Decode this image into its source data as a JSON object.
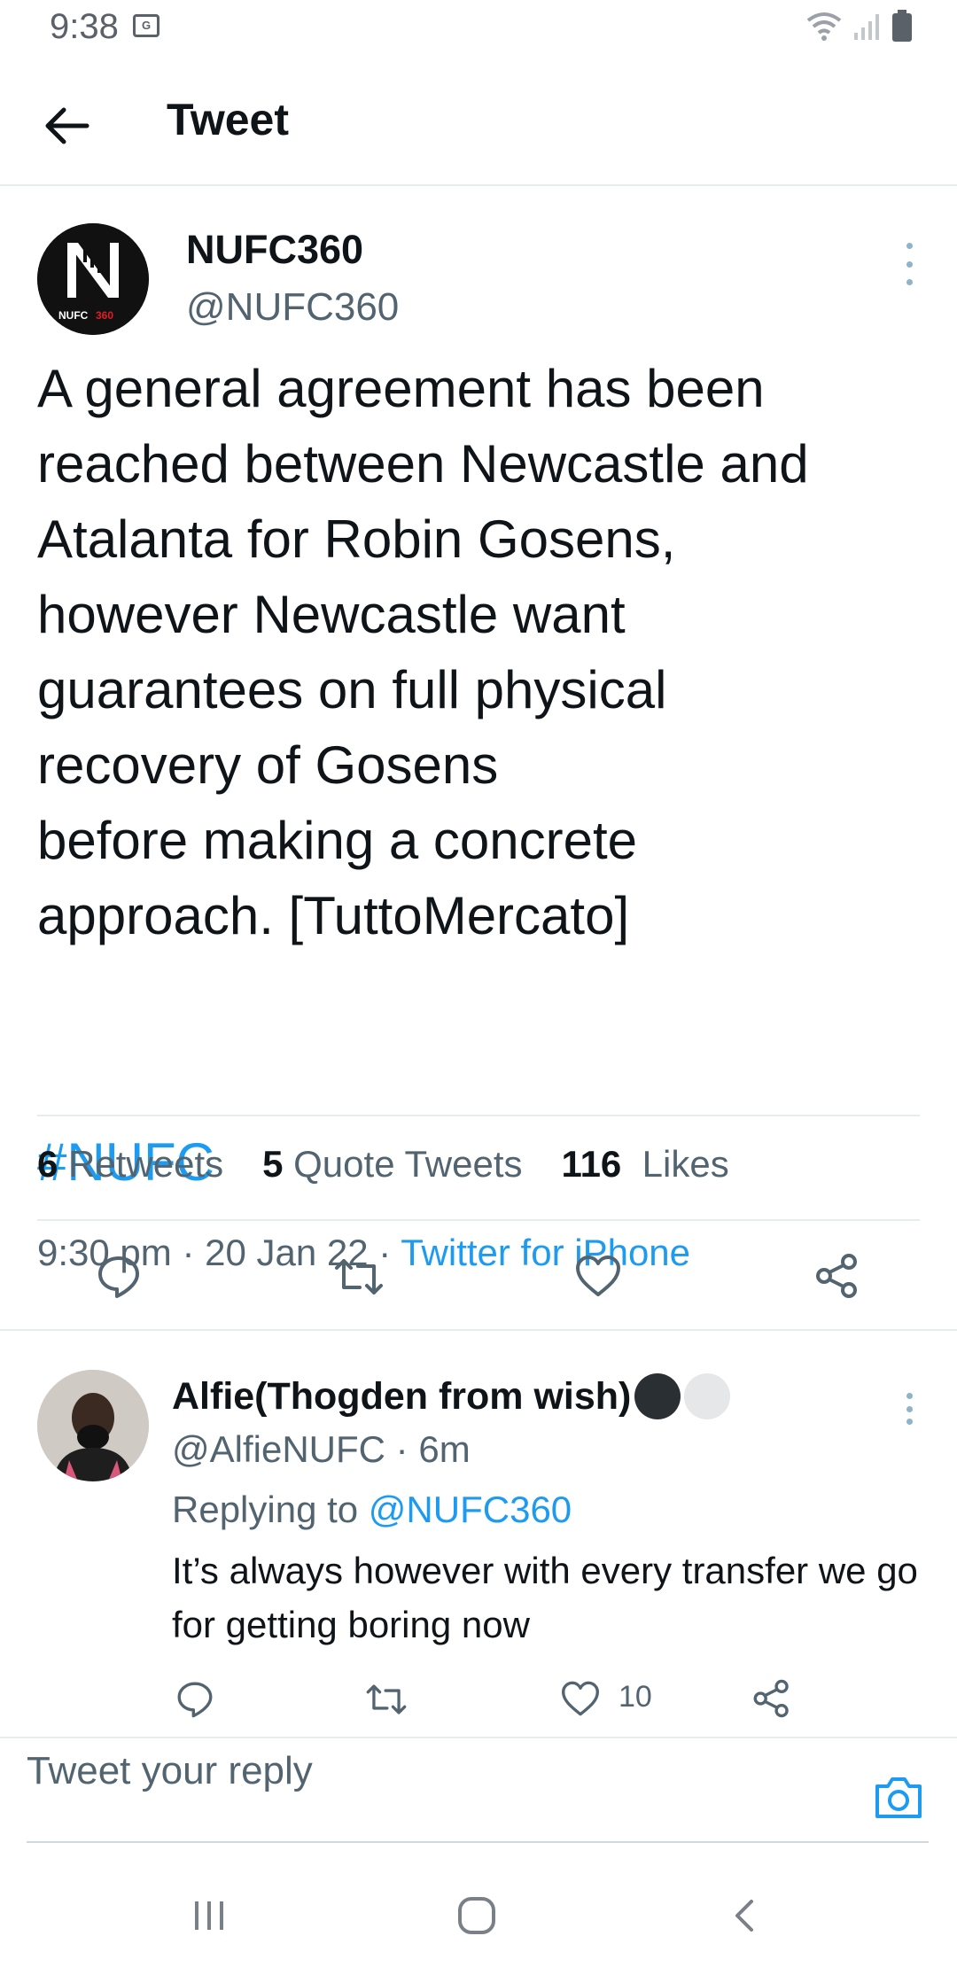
{
  "status_bar": {
    "time": "9:38",
    "notification_badge": "G",
    "icons": [
      "wifi-icon",
      "signal-icon",
      "battery-icon"
    ]
  },
  "header": {
    "title": "Tweet",
    "back_icon": "arrow-left-icon"
  },
  "tweet": {
    "author_name": "NUFC360",
    "author_handle": "@NUFC360",
    "avatar_text": "NUFC 360",
    "text": "A general agreement has been\nreached between Newcastle and\nAtalanta for Robin Gosens,\nhowever Newcastle want\nguarantees on full physical\nrecovery of Gosens\nbefore making a concrete\napproach. [TuttoMercato]",
    "hashtag": "#NUFC",
    "time": "9:30 pm",
    "separator": "·",
    "date": "20 Jan 22",
    "source": "Twitter for iPhone",
    "stats": {
      "retweets_count": "6",
      "retweets_label": "Retweets",
      "quotes_count": "5",
      "quotes_label": "Quote Tweets",
      "likes_count": "116",
      "likes_label": "Likes"
    }
  },
  "reply": {
    "author_name": "Alfie(Thogden from wish)",
    "author_handle": "@AlfieNUFC",
    "separator": "·",
    "time_ago": "6m",
    "replying_to_label": "Replying to",
    "replying_to_mention": "@NUFC360",
    "text": "It’s always however with every transfer we go for getting boring now",
    "like_count": "10"
  },
  "compose": {
    "placeholder": "Tweet your reply"
  },
  "colors": {
    "accent": "#1d9bf0",
    "text": "#0f1419",
    "secondary_text": "#536471",
    "divider": "#e6ecf0"
  }
}
